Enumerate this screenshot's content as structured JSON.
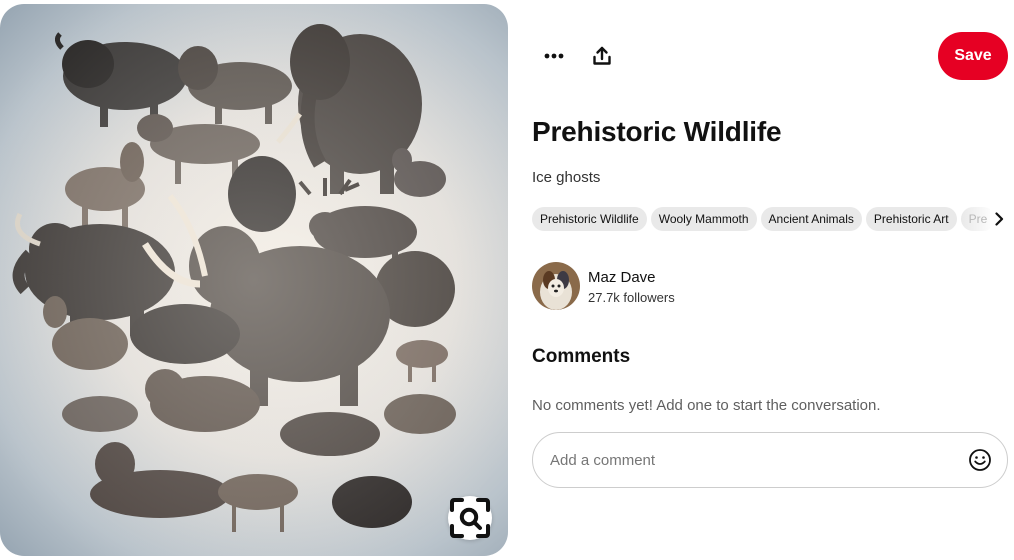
{
  "pin": {
    "title": "Prehistoric Wildlife",
    "description": "Ice ghosts",
    "image_alt": "Prehistoric animals illustration"
  },
  "toolbar": {
    "more_icon": "ellipsis-icon",
    "share_icon": "share-upload-icon",
    "save_label": "Save"
  },
  "tags": [
    "Prehistoric Wildlife",
    "Wooly Mammoth",
    "Ancient Animals",
    "Prehistoric Art",
    "Pre"
  ],
  "creator": {
    "name": "Maz Dave",
    "followers": "27.7k followers"
  },
  "comments": {
    "title": "Comments",
    "empty_text": "No comments yet! Add one to start the conversation.",
    "input_placeholder": "Add a comment"
  },
  "colors": {
    "save_red": "#e60023",
    "tag_bg": "#e9e9e9"
  }
}
